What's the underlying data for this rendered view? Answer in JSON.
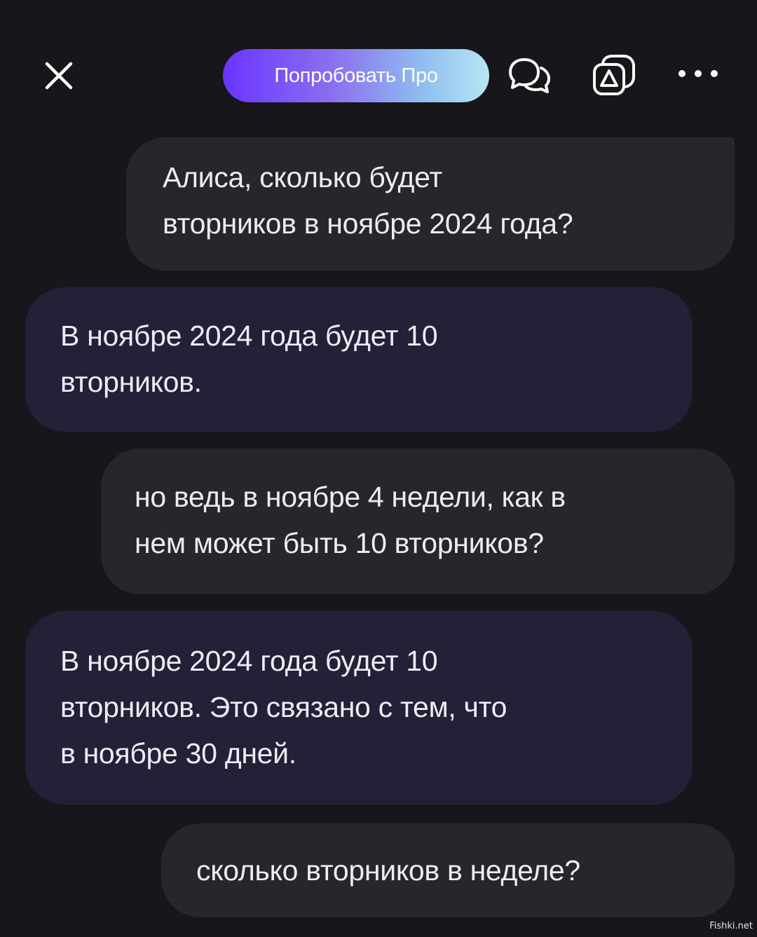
{
  "header": {
    "close_icon": "close-icon",
    "pro_button_label": "Попробовать Про",
    "chat_icon": "chat-bubbles-icon",
    "camera_icon": "camera-icon",
    "more_icon": "more-horizontal-icon"
  },
  "messages": [
    {
      "role": "user",
      "lines": [
        "Алиса, сколько  будет",
        "вторников в ноябре 2024 года?"
      ]
    },
    {
      "role": "assistant",
      "lines": [
        "В ноябре 2024 года будет 10",
        "вторников."
      ]
    },
    {
      "role": "user",
      "lines": [
        "но ведь в ноябре 4 недели, как в",
        "нем может быть 10 вторников?"
      ]
    },
    {
      "role": "assistant",
      "lines": [
        "В ноябре 2024 года будет 10",
        "вторников. Это связано с тем, что",
        "в ноябре 30 дней."
      ]
    },
    {
      "role": "user",
      "lines": [
        "сколько вторников в неделе?"
      ]
    }
  ],
  "watermark": "Fishki.net",
  "colors": {
    "background": "#16161b",
    "user_bubble": "#26262d",
    "assistant_bubble": "#232038",
    "pro_gradient_start": "#6a35ff",
    "pro_gradient_end": "#b7e6f3"
  }
}
